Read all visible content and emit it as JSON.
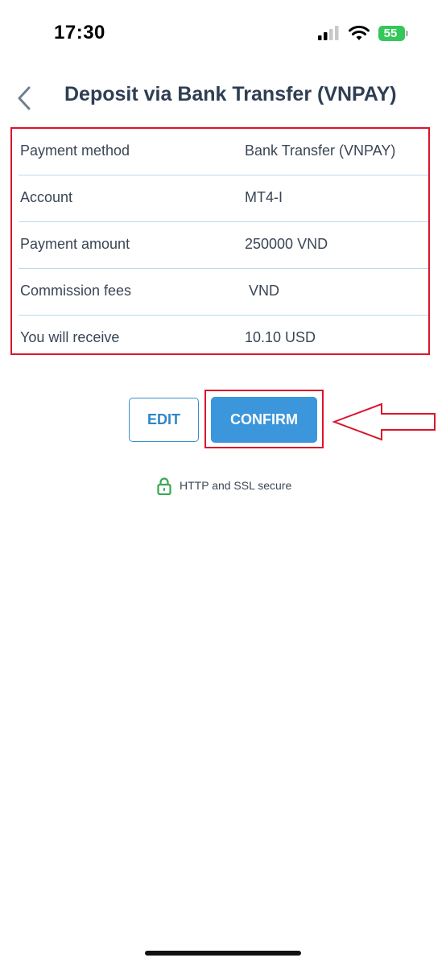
{
  "status_bar": {
    "time": "17:30",
    "battery": "55"
  },
  "header": {
    "title": "Deposit via Bank Transfer (VNPAY)"
  },
  "summary": {
    "rows": [
      {
        "label": "Payment method",
        "value": "Bank Transfer (VNPAY)"
      },
      {
        "label": "Account",
        "value": "MT4-I"
      },
      {
        "label": "Payment amount",
        "value": "250000 VND"
      },
      {
        "label": "Commission fees",
        "value": " VND"
      },
      {
        "label": "You will receive",
        "value": "10.10 USD"
      }
    ]
  },
  "actions": {
    "edit_label": "EDIT",
    "confirm_label": "CONFIRM"
  },
  "security": {
    "note": "HTTP and SSL secure"
  },
  "colors": {
    "accent": "#3b96db",
    "annotation": "#d9152b",
    "divider": "#b9dcec",
    "lock": "#3aa655"
  }
}
